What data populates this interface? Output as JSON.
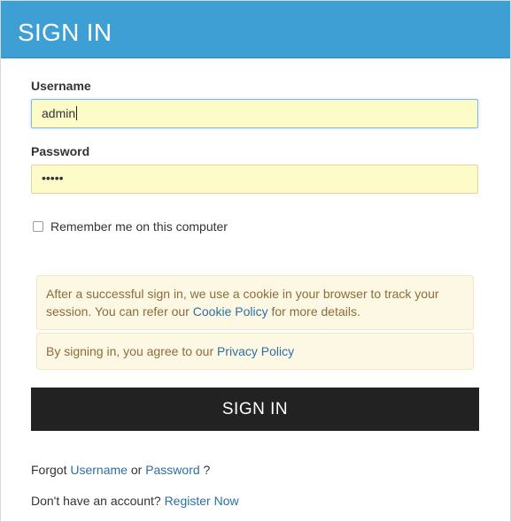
{
  "header": {
    "title": "SIGN IN"
  },
  "form": {
    "username": {
      "label": "Username",
      "value": "admin"
    },
    "password": {
      "label": "Password",
      "masked_value": "•••••"
    },
    "remember_me": {
      "label": "Remember me on this computer",
      "checked": false
    }
  },
  "notices": {
    "cookie": {
      "text_before": "After a successful sign in, we use a cookie in your browser to track your session. You can refer our ",
      "link_text": "Cookie Policy",
      "text_after": " for more details."
    },
    "privacy": {
      "text_before": "By signing in, you agree to our ",
      "link_text": "Privacy Policy"
    }
  },
  "submit": {
    "label": "SIGN IN"
  },
  "footer": {
    "forgot_prefix": "Forgot ",
    "forgot_username_link": "Username",
    "forgot_or": " or ",
    "forgot_password_link": "Password",
    "forgot_suffix": " ?",
    "register_prefix": "Don't have an account? ",
    "register_link": "Register Now"
  },
  "colors": {
    "header_bg": "#3d9fd3",
    "input_bg": "#fdfbc8",
    "notice_bg": "#fcf8e3",
    "notice_text": "#8a6d3b",
    "link": "#2d6fa5",
    "button_bg": "#222222"
  }
}
